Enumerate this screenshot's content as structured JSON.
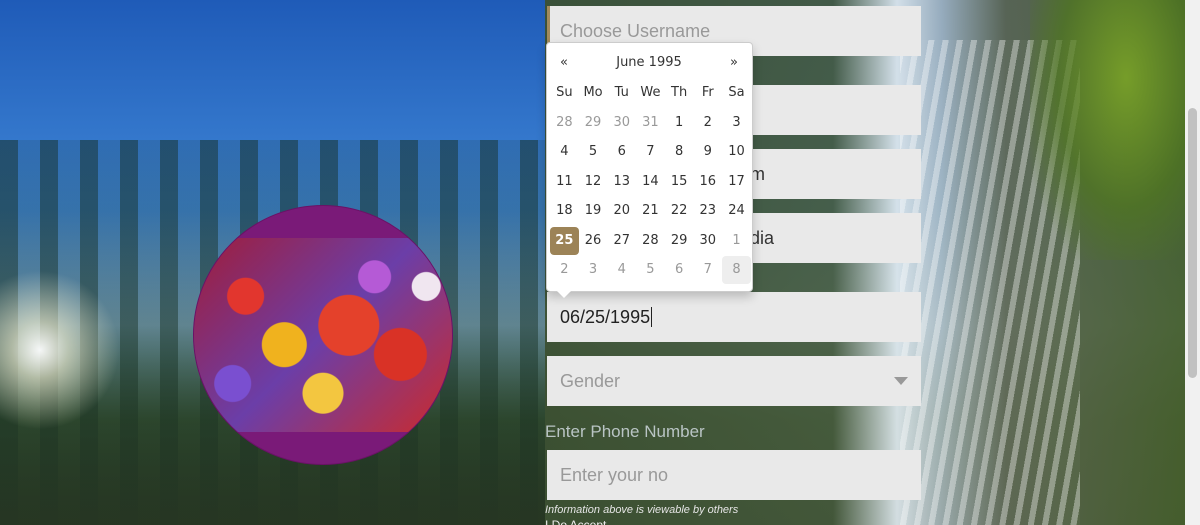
{
  "form": {
    "username_placeholder": "Choose Username",
    "field3_partial": "m",
    "field4_partial": "dia",
    "dob_value": "06/25/1995",
    "gender_placeholder": "Gender",
    "phone_label": "Enter Phone Number",
    "phone_placeholder": "Enter your no",
    "info_note": "Information above is viewable by others",
    "bottom_fragment": "I Do Accept"
  },
  "datepicker": {
    "prev": "«",
    "next": "»",
    "title": "June 1995",
    "weekdays": [
      "Su",
      "Mo",
      "Tu",
      "We",
      "Th",
      "Fr",
      "Sa"
    ],
    "weeks": [
      [
        "28",
        "29",
        "30",
        "31",
        "1",
        "2",
        "3"
      ],
      [
        "4",
        "5",
        "6",
        "7",
        "8",
        "9",
        "10"
      ],
      [
        "11",
        "12",
        "13",
        "14",
        "15",
        "16",
        "17"
      ],
      [
        "18",
        "19",
        "20",
        "21",
        "22",
        "23",
        "24"
      ],
      [
        "25",
        "26",
        "27",
        "28",
        "29",
        "30",
        "1"
      ],
      [
        "2",
        "3",
        "4",
        "5",
        "6",
        "7",
        "8"
      ]
    ],
    "selected": "25",
    "accent_color": "#9c8357"
  },
  "colors": {
    "avatar_border": "#7a1a78",
    "field_bg": "#e9e9e9",
    "username_accent": "#a18a5c"
  }
}
